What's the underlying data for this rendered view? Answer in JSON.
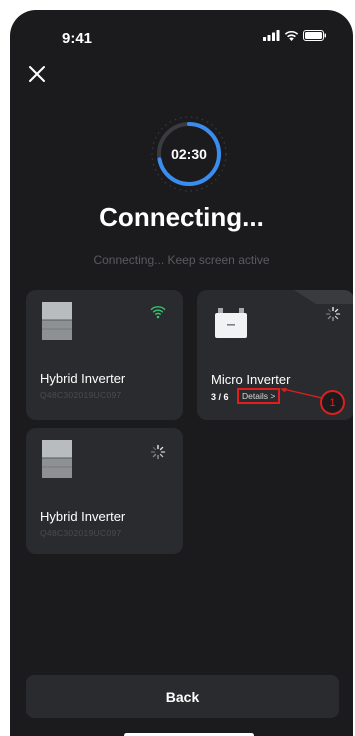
{
  "status_bar": {
    "time": "9:41"
  },
  "timer": {
    "value": "02:30",
    "progress": 0.72
  },
  "title": "Connecting...",
  "subtitle": "Connecting... Keep screen active",
  "devices": [
    {
      "name": "Hybrid Inverter",
      "serial": "Q48C302019UC097",
      "status": "wifi-connected"
    },
    {
      "name": "Micro Inverter",
      "progress": "3 / 6",
      "details_label": "Details >",
      "status": "loading"
    },
    {
      "name": "Hybrid Inverter",
      "serial": "Q48C302019UC097",
      "status": "loading"
    }
  ],
  "callout": {
    "number": "1",
    "color": "#e01e1e"
  },
  "back_button": {
    "label": "Back"
  },
  "colors": {
    "background": "#1b1b1d",
    "card": "#2a2b2e",
    "accent_blue": "#3a8df0",
    "wifi_green": "#35c46a"
  }
}
